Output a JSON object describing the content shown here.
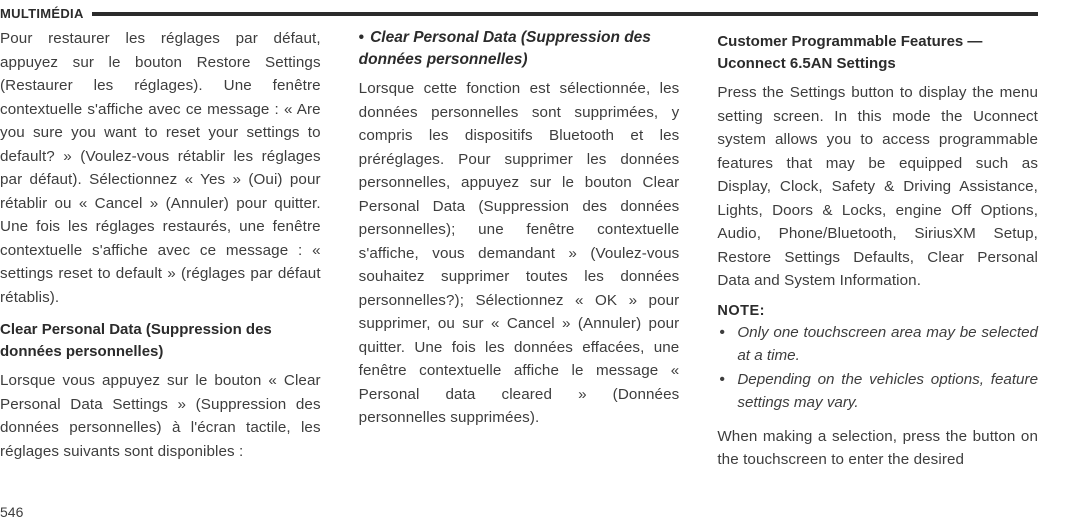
{
  "header": {
    "section": "MULTIMÉDIA"
  },
  "col1": {
    "p1": "Pour restaurer les réglages par défaut, appuyez sur le bouton Restore Settings (Restaurer les réglages). Une fenêtre contextuelle s'affiche avec ce message : « Are you sure you want to reset your settings to default? » (Voulez-vous rétablir les réglages par défaut). Sélectionnez « Yes » (Oui) pour rétablir ou « Cancel » (Annuler) pour quitter. Une fois les réglages restaurés, une fenêtre contextuelle s'affiche avec ce message : « settings reset to default » (réglages par défaut rétablis).",
    "h1": "Clear Personal Data (Suppression des données personnelles)",
    "p2": "Lorsque vous appuyez sur le bouton « Clear Personal Data Settings » (Suppression des données personnelles) à l'écran tactile, les réglages suivants sont disponibles :"
  },
  "col2": {
    "bulletHead": "Clear Personal Data (Suppression des données personnelles)",
    "p1": "Lorsque cette fonction est sélectionnée, les données personnelles sont supprimées, y compris les dispositifs Bluetooth et les préréglages. Pour supprimer les données personnelles, appuyez sur le bouton Clear Personal Data (Suppression des données personnelles); une fenêtre contextuelle s'affiche, vous demandant  » (Voulez-vous souhaitez supprimer toutes les données personnelles?); Sélectionnez « OK » pour supprimer, ou sur « Cancel » (Annuler) pour quitter. Une fois les données effacées, une fenêtre contextuelle affiche le message « Personal data cleared » (Données personnelles supprimées)."
  },
  "col3": {
    "h1": "Customer Programmable Features — Uconnect 6.5AN Settings",
    "p1": "Press the Settings button to display the menu setting screen. In this mode the Uconnect system allows you to access programmable features that may be equipped such as Display, Clock, Safety & Driving Assistance, Lights, Doors & Locks, engine Off Options, Audio, Phone/Bluetooth, SiriusXM Setup, Restore Settings Defaults, Clear Personal Data and System Information.",
    "noteLabel": "NOTE:",
    "notes": [
      "Only one touchscreen area may be selected at a time.",
      "Depending on the vehicles options, feature settings may vary."
    ],
    "p2": "When making a selection, press the button on the touchscreen to enter the desired"
  },
  "pageNumber": "546"
}
